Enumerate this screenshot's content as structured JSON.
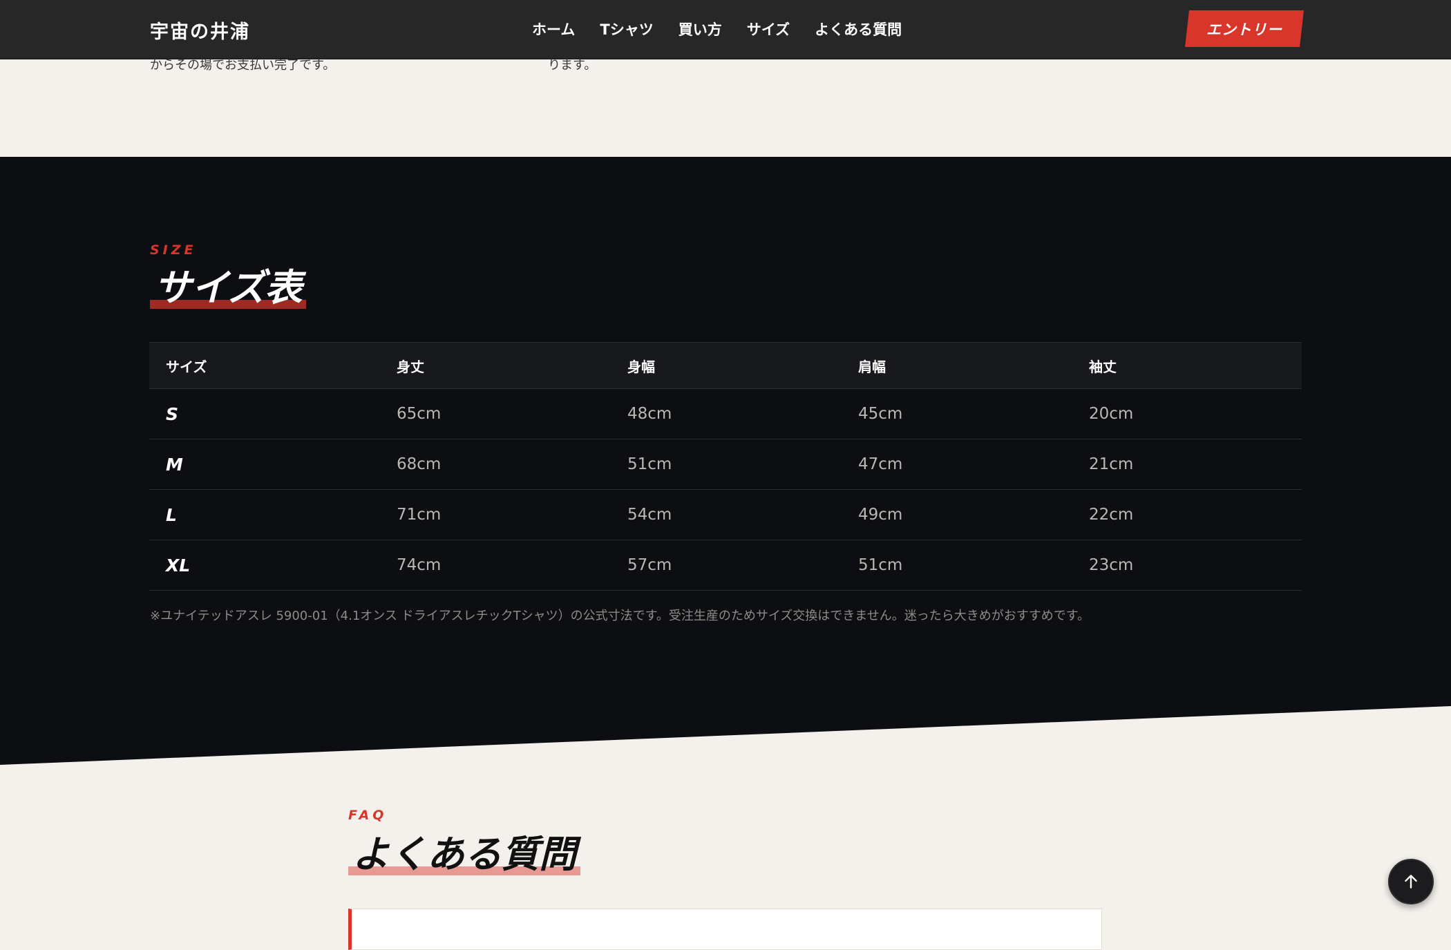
{
  "header": {
    "logo": "宇宙の井浦",
    "nav": [
      "ホーム",
      "Tシャツ",
      "買い方",
      "サイズ",
      "よくある質問"
    ],
    "entry_label": "エントリー"
  },
  "prev_section": {
    "text_left": "からその場でお支払い完了です。",
    "text_mid": "ります。"
  },
  "size_section": {
    "eyebrow": "SIZE",
    "title": "サイズ表",
    "columns": [
      "サイズ",
      "身丈",
      "身幅",
      "肩幅",
      "袖丈"
    ],
    "rows": [
      [
        "S",
        "65cm",
        "48cm",
        "45cm",
        "20cm"
      ],
      [
        "M",
        "68cm",
        "51cm",
        "47cm",
        "21cm"
      ],
      [
        "L",
        "71cm",
        "54cm",
        "49cm",
        "22cm"
      ],
      [
        "XL",
        "74cm",
        "57cm",
        "51cm",
        "23cm"
      ]
    ],
    "note": "※ユナイテッドアスレ 5900-01（4.1オンス ドライアスレチックTシャツ）の公式寸法です。受注生産のためサイズ交換はできません。迷ったら大きめがおすすめです。"
  },
  "faq_section": {
    "eyebrow": "FAQ",
    "title": "よくある質問"
  },
  "icons": {
    "back_to_top": "arrow-up-icon"
  },
  "colors": {
    "accent": "#d9362b",
    "dark_bg": "#0d0e12",
    "light_bg": "#f4f1ec"
  }
}
